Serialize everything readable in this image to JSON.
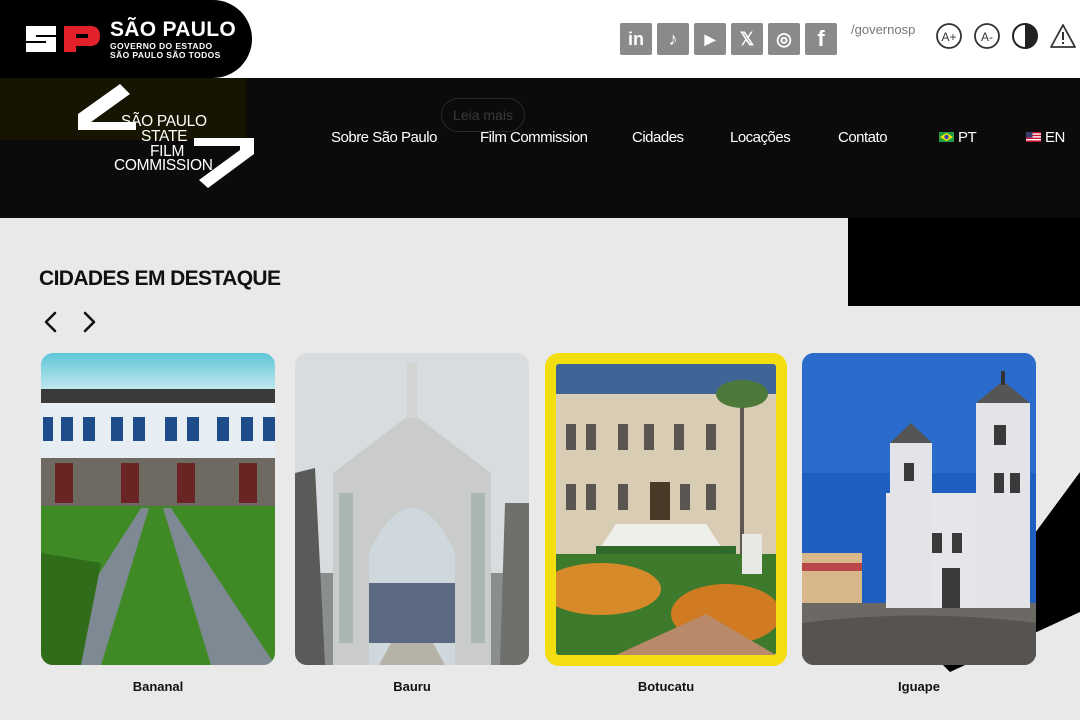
{
  "gov": {
    "name": "SÃO PAULO",
    "line2": "GOVERNO DO ESTADO",
    "line3": "SÃO PAULO SÃO TODOS",
    "handle": "/governosp"
  },
  "social": [
    {
      "icon": "linkedin-icon",
      "glyph": "in"
    },
    {
      "icon": "tiktok-icon",
      "glyph": "♪"
    },
    {
      "icon": "youtube-icon",
      "glyph": "▶"
    },
    {
      "icon": "x-icon",
      "glyph": "𝕏"
    },
    {
      "icon": "instagram-icon",
      "glyph": "◎"
    },
    {
      "icon": "facebook-icon",
      "glyph": "f"
    }
  ],
  "accessibility": {
    "increase": "A+",
    "decrease": "A-"
  },
  "header": {
    "ghost_button": "Leia mais",
    "logo": {
      "line1": "SÃO PAULO",
      "line2": "STATE",
      "line3": "FILM",
      "line4": "COMMISSION"
    },
    "nav": [
      {
        "label": "Sobre São Paulo"
      },
      {
        "label": "Film Commission"
      },
      {
        "label": "Cidades"
      },
      {
        "label": "Locações"
      },
      {
        "label": "Contato"
      },
      {
        "label": "PT"
      },
      {
        "label": "EN"
      }
    ]
  },
  "featured": {
    "title": "CIDADES EM DESTAQUE",
    "cities": [
      {
        "name": "Bananal"
      },
      {
        "name": "Bauru"
      },
      {
        "name": "Botucatu"
      },
      {
        "name": "Iguape"
      }
    ]
  },
  "colors": {
    "accent_yellow": "#f3de12",
    "header_black": "#0b0b0b",
    "sp_red": "#e3212a"
  }
}
